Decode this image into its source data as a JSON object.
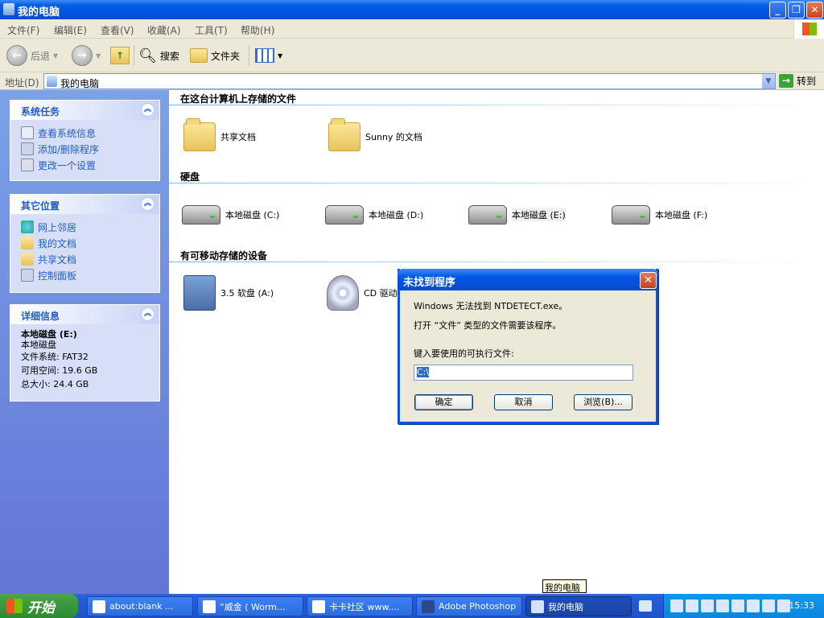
{
  "window": {
    "title": "我的电脑",
    "minimize": "_",
    "maximize": "❐",
    "close": "✕"
  },
  "menu": [
    "文件(F)",
    "编辑(E)",
    "查看(V)",
    "收藏(A)",
    "工具(T)",
    "帮助(H)"
  ],
  "toolbar": {
    "back": "后退",
    "search": "搜索",
    "folders": "文件夹"
  },
  "address": {
    "label": "地址(D)",
    "value": "我的电脑",
    "go": "转到"
  },
  "left_panels": {
    "tasks": {
      "title": "系统任务",
      "items": [
        "查看系统信息",
        "添加/删除程序",
        "更改一个设置"
      ]
    },
    "places": {
      "title": "其它位置",
      "items": [
        "网上邻居",
        "我的文档",
        "共享文档",
        "控制面板"
      ]
    },
    "details": {
      "title": "详细信息",
      "name": "本地磁盘 (E:)",
      "type": "本地磁盘",
      "fs": "文件系统: FAT32",
      "free": "可用空间: 19.6 GB",
      "total": "总大小: 24.4 GB"
    }
  },
  "content": {
    "group_files": "在这台计算机上存储的文件",
    "shared_docs": "共享文档",
    "sunny_docs": "Sunny 的文档",
    "group_hdd": "硬盘",
    "drives": [
      "本地磁盘 (C:)",
      "本地磁盘 (D:)",
      "本地磁盘 (E:)",
      "本地磁盘 (F:)"
    ],
    "group_removable": "有可移动存储的设备",
    "floppy": "3.5 软盘 (A:)",
    "cd": "CD 驱动"
  },
  "dialog": {
    "title": "未找到程序",
    "line1": "Windows 无法找到 NTDETECT.exe。",
    "line2": "打开 “文件” 类型的文件需要该程序。",
    "prompt": "键入要使用的可执行文件:",
    "input_value": "C:\\",
    "ok": "确定",
    "cancel": "取消",
    "browse": "浏览(B)..."
  },
  "tooltip": "我的电脑",
  "taskbar": {
    "start": "开始",
    "tasks": [
      "about:blank ...",
      "“威金 ( Worm...",
      "卡卡社区 www....",
      "Adobe Photoshop",
      "我的电脑"
    ],
    "clock": "15:33"
  }
}
